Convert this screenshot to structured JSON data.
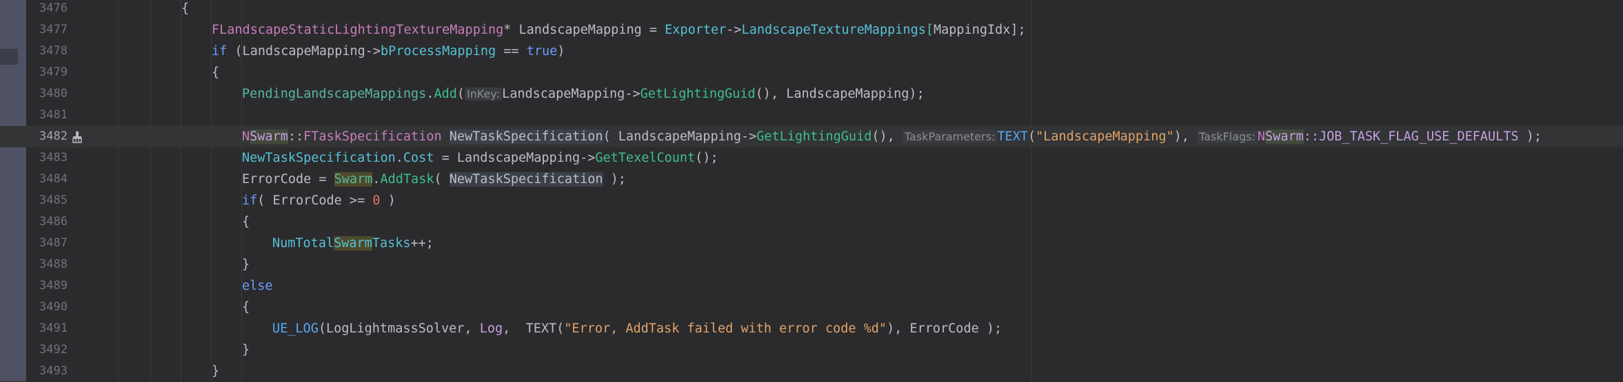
{
  "editor": {
    "lines": [
      {
        "num": "3476"
      },
      {
        "num": "3477"
      },
      {
        "num": "3478"
      },
      {
        "num": "3479"
      },
      {
        "num": "3480"
      },
      {
        "num": "3481"
      },
      {
        "num": "3482"
      },
      {
        "num": "3483"
      },
      {
        "num": "3484"
      },
      {
        "num": "3485"
      },
      {
        "num": "3486"
      },
      {
        "num": "3487"
      },
      {
        "num": "3488"
      },
      {
        "num": "3489"
      },
      {
        "num": "3490"
      },
      {
        "num": "3491"
      },
      {
        "num": "3492"
      },
      {
        "num": "3493"
      }
    ],
    "tokens": {
      "l3476": {
        "brace": "{"
      },
      "l3477": {
        "type": "FLandscapeStaticLightingTextureMapping",
        "star": "*",
        "var": " LandscapeMapping = ",
        "exp": "Exporter",
        "arrow": "->",
        "fld": "LandscapeTextureMappings",
        "lb": "[",
        "idx": "MappingIdx",
        "rb": "];"
      },
      "l3478": {
        "kw": "if",
        "p1": " (LandscapeMapping->",
        "fld": "bProcessMapping",
        "op": " == ",
        "val": "true",
        "p2": ")"
      },
      "l3479": {
        "brace": "{"
      },
      "l3480": {
        "obj": "PendingLandscapeMappings",
        "dot": ".",
        "fn": "Add",
        "p1": "(",
        "hint": "InKey:",
        "p2": "LandscapeMapping->",
        "call": "GetLightingGuid",
        "p3": "(), LandscapeMapping);"
      },
      "l3482": {
        "ns1": "N",
        "ns2": "Swarm",
        "sep": "::",
        "type": "FTaskSpecification",
        "sp": " ",
        "var": "NewTaskSpecification",
        "p1": "( LandscapeMapping->",
        "call": "GetLightingGuid",
        "p2": "(), ",
        "hint1": "TaskParameters:",
        "mac": "TEXT",
        "p3": "(",
        "str": "\"LandscapeMapping\"",
        "p4": "), ",
        "hint2": "TaskFlags:",
        "ns3": "N",
        "ns4": "Swarm",
        "cst": "::JOB_TASK_FLAG_USE_DEFAULTS",
        "p5": " );"
      },
      "l3483": {
        "var": "NewTaskSpecification",
        "dot": ".",
        "fld": "Cost",
        "p1": " = LandscapeMapping->",
        "call": "GetTexelCount",
        "p2": "();"
      },
      "l3484": {
        "p1": "ErrorCode = ",
        "obj": "Swarm",
        "dot": ".",
        "call": "AddTask",
        "p2": "( ",
        "var": "NewTaskSpecification",
        "p3": " );"
      },
      "l3485": {
        "kw": "if",
        "p1": "( ErrorCode >= ",
        "num": "0",
        "p2": " )"
      },
      "l3486": {
        "brace": "{"
      },
      "l3487": {
        "a": "NumTotal",
        "b": "Swarm",
        "c": "Tasks",
        "d": "++;"
      },
      "l3488": {
        "brace": "}"
      },
      "l3489": {
        "kw": "else"
      },
      "l3490": {
        "brace": "{"
      },
      "l3491": {
        "mac": "UE_LOG",
        "p1": "(LogLightmassSolver, ",
        "lg": "Log",
        "p2": ",  TEXT(",
        "str": "\"Error, AddTask failed with error code %d\"",
        "p3": "), ErrorCode );"
      },
      "l3492": {
        "brace": "}"
      },
      "l3493": {
        "brace": "}"
      }
    },
    "gutter_icon": "brush-icon"
  }
}
